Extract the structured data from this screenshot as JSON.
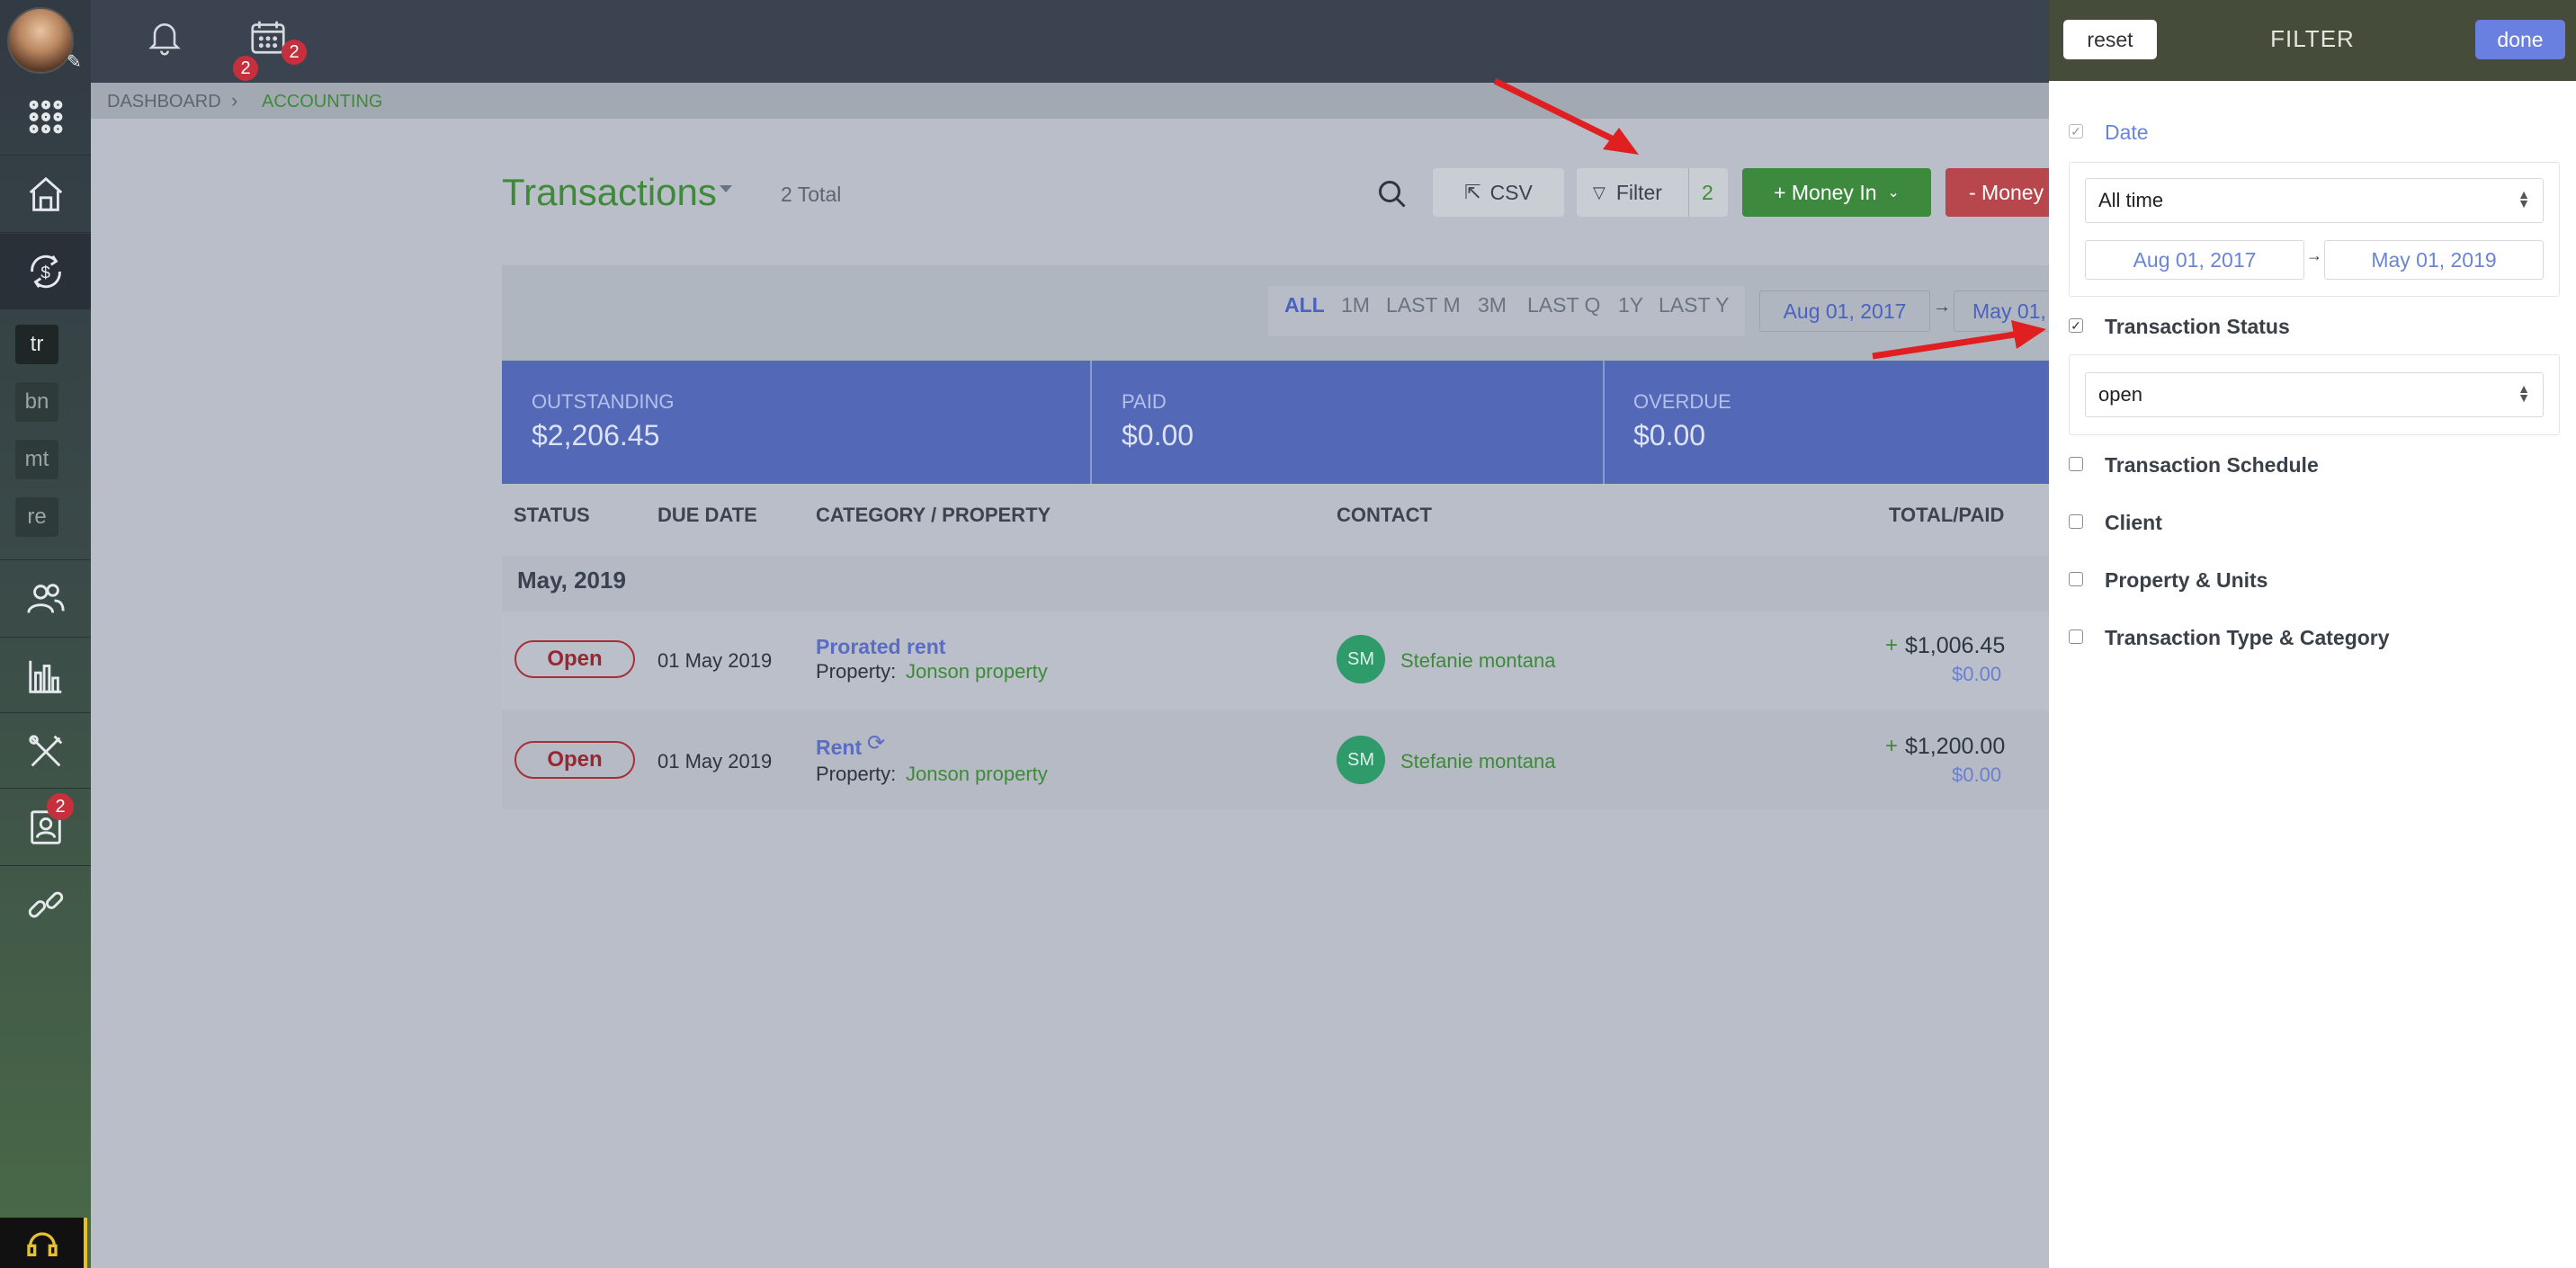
{
  "topbar": {
    "notif_count": "2",
    "calendar_count": "2"
  },
  "sidebar": {
    "sections": [
      "tr",
      "bn",
      "mt",
      "re"
    ],
    "contacts_badge": "2",
    "icons": [
      "apps-grid-icon",
      "home-icon",
      "accounting-icon",
      "people-icon",
      "reports-chart-icon",
      "tools-icon",
      "contact-card-icon",
      "link-icon",
      "support-headset-icon"
    ]
  },
  "breadcrumb": {
    "items": [
      "DASHBOARD",
      "ACCOUNTING"
    ]
  },
  "page": {
    "title": "Transactions",
    "total": "2 Total"
  },
  "toolbar": {
    "csv_label": "CSV",
    "filter_label": "Filter",
    "filter_count": "2",
    "money_in_label": "+ Money In",
    "money_out_label": "- Money"
  },
  "ranges": {
    "items": [
      "ALL",
      "1M",
      "LAST M",
      "3M",
      "LAST Q",
      "1Y",
      "LAST Y"
    ],
    "from": "Aug 01, 2017",
    "to": "May 01,"
  },
  "summary": {
    "outstanding_label": "OUTSTANDING",
    "outstanding_value": "$2,206.45",
    "paid_label": "PAID",
    "paid_value": "$0.00",
    "overdue_label": "OVERDUE",
    "overdue_value": "$0.00"
  },
  "table": {
    "headers": [
      "STATUS",
      "DUE DATE",
      "CATEGORY / PROPERTY",
      "CONTACT",
      "TOTAL/PAID"
    ],
    "group": "May, 2019",
    "rows": [
      {
        "status": "Open",
        "due": "01 May 2019",
        "category": "Prorated rent",
        "property_prefix": "Property:",
        "property": "Jonson property",
        "contact_initials": "SM",
        "contact": "Stefanie montana",
        "total": "$1,006.45",
        "paid": "$0.00"
      },
      {
        "status": "Open",
        "due": "01 May 2019",
        "category": "Rent",
        "property_prefix": "Property:",
        "property": "Jonson property",
        "contact_initials": "SM",
        "contact": "Stefanie montana",
        "total": "$1,200.00",
        "paid": "$0.00"
      }
    ]
  },
  "filter": {
    "reset_label": "reset",
    "title": "FILTER",
    "done_label": "done",
    "date_label": "Date",
    "date_select": "All time",
    "date_from": "Aug 01, 2017",
    "date_to": "May 01, 2019",
    "status_label": "Transaction Status",
    "status_select": "open",
    "schedule_label": "Transaction Schedule",
    "client_label": "Client",
    "property_label": "Property & Units",
    "type_label": "Transaction Type & Category"
  },
  "colors": {
    "accent_green": "#3f9a40",
    "money_out_red": "#c4434b",
    "summary_blue": "#5a6fc6",
    "filter_head": "#454c3a"
  }
}
